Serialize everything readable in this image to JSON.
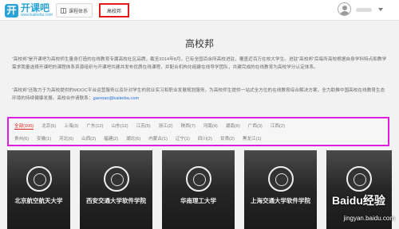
{
  "header": {
    "logo_mark": "开",
    "logo_name": "开课吧",
    "logo_domain": "www.kaikeba.com",
    "courses_label": "课程体系",
    "gxb_label": "高校邦"
  },
  "page": {
    "title": "高校邦",
    "intro_1": "“高校邦”是开课吧为高校师生量身打造的在线教育专属高校社区品牌，截至2014年8月，已有全国百余所高校进驻，覆盖近百万在校大学生。进驻“高校邦”后每所高校根据自身学科特点和教学需求我量选择开课吧的课程体系资源组织与开课吧共建并发布优质在线课程，并配合机构化组建在线导学团队，共建完成的在线教育为高校学分认定体系。",
    "intro_2_text": "“高校邦”还致力于为高校提供的MOOC平台运营服务以及针对学生的就业实习和职业发展规划服务，为高校师生提供一站式全方位的在线教育综合解决方案，全力助推中国高校在线教育生态环境的持续健康发展。高校合作请联系：",
    "intro_2_email": "gaoxiao@kaikeba.com"
  },
  "filters": {
    "row1": [
      {
        "label": "全部(100)",
        "active": true
      },
      {
        "label": "北京(5)"
      },
      {
        "label": "上海(3)"
      },
      {
        "label": "广东(12)"
      },
      {
        "label": "山东(12)"
      },
      {
        "label": "江苏(5)"
      },
      {
        "label": "浙江(2)"
      },
      {
        "label": "陕西(7)"
      },
      {
        "label": "河南(4)"
      },
      {
        "label": "湖南(6)"
      },
      {
        "label": "广西(3)"
      },
      {
        "label": "江西(2)"
      }
    ],
    "row2": [
      {
        "label": "贵州(6)"
      },
      {
        "label": "安徽(1)"
      },
      {
        "label": "河北(6)"
      },
      {
        "label": "山西(2)"
      },
      {
        "label": "福建(2)"
      },
      {
        "label": "湖北(6)"
      },
      {
        "label": "内蒙古(1)"
      },
      {
        "label": "辽宁(1)"
      },
      {
        "label": "四川(2)"
      },
      {
        "label": "甘肃(2)"
      },
      {
        "label": "黑龙江(1)"
      }
    ]
  },
  "cards": [
    {
      "name": "北京航空航天大学"
    },
    {
      "name": "西安交通大学软件学院"
    },
    {
      "name": "华南理工大学"
    },
    {
      "name": "上海交通大学软件学院"
    },
    {
      "name": ""
    }
  ],
  "watermark": {
    "logo": "Baidu经验",
    "text": "jingyan.baidu.com"
  },
  "colors": {
    "brand": "#2aa3d8",
    "highlight_red": "#e11a1a",
    "highlight_magenta": "#dd1edd",
    "link": "#1f6fd6"
  }
}
